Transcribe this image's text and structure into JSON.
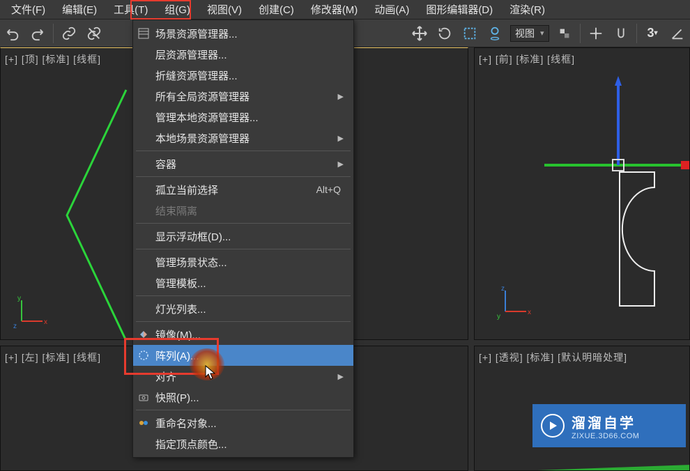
{
  "menubar": {
    "file": "文件(F)",
    "edit": "编辑(E)",
    "tools": "工具(T)",
    "group": "组(G)",
    "view": "视图(V)",
    "create": "创建(C)",
    "modifier": "修改器(M)",
    "anim": "动画(A)",
    "grapheditor": "图形编辑器(D)",
    "render": "渲染(R)"
  },
  "toolbar": {
    "view_label": "视图"
  },
  "viewports": {
    "tl": "[+] [顶] [标准] [线框]",
    "tr": "[+] [前] [标准] [线框]",
    "bl": "[+] [左] [标准] [线框]",
    "br": "[+] [透视] [标准] [默认明暗处理]"
  },
  "menu": {
    "scene_explorer": "场景资源管理器...",
    "layer_explorer": "层资源管理器...",
    "fold_explorer": "折缝资源管理器...",
    "all_global_explorers": "所有全局资源管理器",
    "manage_local_explorers": "管理本地资源管理器...",
    "local_scene_explorers": "本地场景资源管理器",
    "container": "容器",
    "isolate_selection": "孤立当前选择",
    "isolate_shortcut": "Alt+Q",
    "end_isolate": "结束隔离",
    "float_viewport": "显示浮动框(D)...",
    "manage_scene_states": "管理场景状态...",
    "manage_templates": "管理模板...",
    "light_list": "灯光列表...",
    "mirror": "镜像(M)...",
    "array": "阵列(A)...",
    "align": "对齐",
    "snapshot": "快照(P)...",
    "rename_objects": "重命名对象...",
    "assign_vertex_color": "指定顶点颜色..."
  },
  "watermark": {
    "cn": "溜溜自学",
    "en": "ZIXUE.3D66.COM"
  }
}
